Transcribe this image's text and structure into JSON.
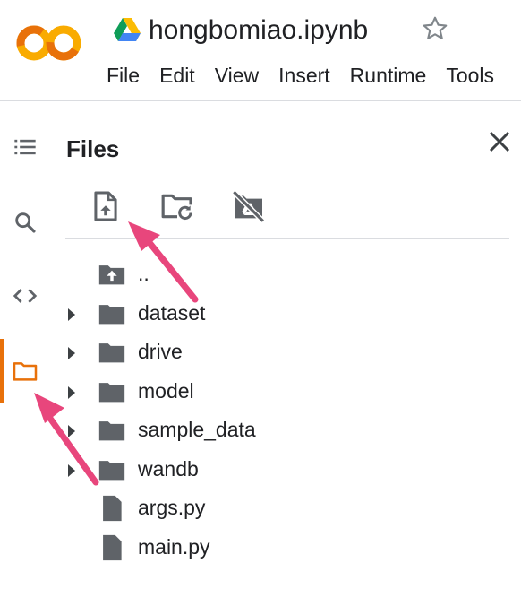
{
  "header": {
    "logo_text": "CO",
    "notebook_title": "hongbomiao.ipynb",
    "menu": [
      "File",
      "Edit",
      "View",
      "Insert",
      "Runtime",
      "Tools"
    ]
  },
  "sidebar_rail": {
    "items": [
      {
        "icon": "table-of-contents-icon",
        "active": false
      },
      {
        "icon": "search-icon",
        "active": false
      },
      {
        "icon": "code-snippets-icon",
        "active": false
      },
      {
        "icon": "folder-icon",
        "active": true
      }
    ],
    "active_color": "#e8710a"
  },
  "files_panel": {
    "title": "Files",
    "toolbar": [
      {
        "icon": "upload-file-icon"
      },
      {
        "icon": "refresh-folder-icon"
      },
      {
        "icon": "unmount-drive-icon"
      }
    ],
    "entries": [
      {
        "name": "..",
        "type": "parent",
        "expandable": false
      },
      {
        "name": "dataset",
        "type": "folder",
        "expandable": true
      },
      {
        "name": "drive",
        "type": "folder",
        "expandable": true
      },
      {
        "name": "model",
        "type": "folder",
        "expandable": true
      },
      {
        "name": "sample_data",
        "type": "folder",
        "expandable": true
      },
      {
        "name": "wandb",
        "type": "folder",
        "expandable": true
      },
      {
        "name": "args.py",
        "type": "file",
        "expandable": false
      },
      {
        "name": "main.py",
        "type": "file",
        "expandable": false
      }
    ]
  },
  "annotation_color": "#e8467c"
}
